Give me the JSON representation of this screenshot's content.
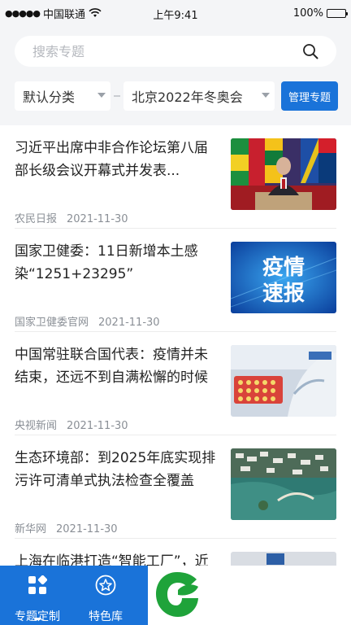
{
  "status_bar": {
    "signal": "●●●●●",
    "carrier": "中国联通",
    "time": "上午9:41",
    "battery": "100%",
    "battery_level": 1.0
  },
  "search": {
    "placeholder": "搜索专题",
    "icon": "search-icon"
  },
  "filters": {
    "category": "默认分类",
    "topic": "北京2022年冬奥会",
    "manage_label": "管理专题"
  },
  "news": [
    {
      "title": "习近平出席中非合作论坛第八届部长级会议开幕式并发表...",
      "source": "农民日报",
      "date": "2021-11-30",
      "image": "flags-meeting-photo"
    },
    {
      "title": "国家卫健委：11日新增本土感染“1251+23295”",
      "source": "国家卫健委官网",
      "date": "2021-11-30",
      "image": "epidemic-bulletin-graphic",
      "image_text": [
        "疫情",
        "速报"
      ]
    },
    {
      "title": "中国常驻联合国代表：疫情并未结束，还远不到自满松懈的时候",
      "source": "央视新闻",
      "date": "2021-11-30",
      "image": "lab-test-tubes-photo"
    },
    {
      "title": "生态环境部：到2025年底实现排污许可清单式执法检查全覆盖",
      "source": "新华网",
      "date": "2021-11-30",
      "image": "water-town-aerial-photo"
    },
    {
      "title": "上海在临港打造“智能工厂”，近",
      "source": "",
      "date": "",
      "image": "partial-photo"
    }
  ],
  "tabs": [
    {
      "label": "专题定制",
      "icon": "grid-icon",
      "active": true
    },
    {
      "label": "特色库",
      "icon": "star-icon",
      "active": false
    }
  ],
  "brand": {
    "logo": "green-leaf-logo",
    "color": "#1fa33a"
  },
  "colors": {
    "accent": "#1a73d9",
    "background": "#f4f5f7"
  }
}
